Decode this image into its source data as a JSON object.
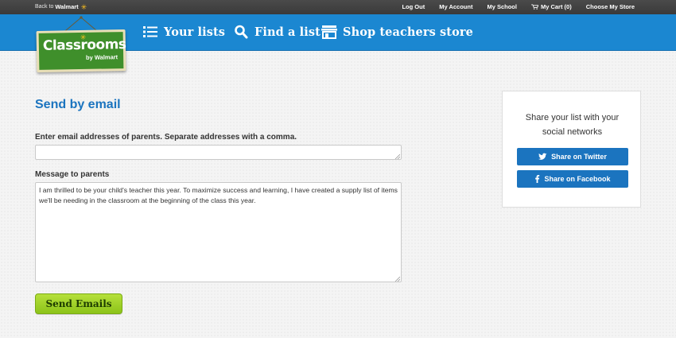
{
  "topbar": {
    "back_prefix": "Back to",
    "back_brand": "Walmart",
    "links": {
      "logout": "Log Out",
      "account": "My Account",
      "school": "My School",
      "cart": "My Cart (0)",
      "store": "Choose My Store"
    }
  },
  "nav": {
    "your_lists": "Your lists",
    "find_list": "Find a list",
    "shop": "Shop teachers store"
  },
  "logo": {
    "title": "Classrooms",
    "by": "by Walmart"
  },
  "form": {
    "title": "Send by email",
    "email_label": "Enter email addresses of parents. Separate addresses with a comma.",
    "email_value": "",
    "message_label": "Message to parents",
    "message_value": "I am thrilled to be your child's teacher this year. To maximize success and learning, I have created a supply list of items we'll be needing in the classroom at the beginning of the class this year.",
    "send_label": "Send Emails"
  },
  "share": {
    "heading_line1": "Share your list with your",
    "heading_line2": "social networks",
    "twitter_label": "Share on Twitter",
    "facebook_label": "Share on Facebook"
  },
  "colors": {
    "nav_blue": "#1b87d1",
    "title_blue": "#1b74bf",
    "send_green": "#9ccf24",
    "logo_green": "#3f8f2b",
    "spark_yellow": "#ffc220"
  }
}
